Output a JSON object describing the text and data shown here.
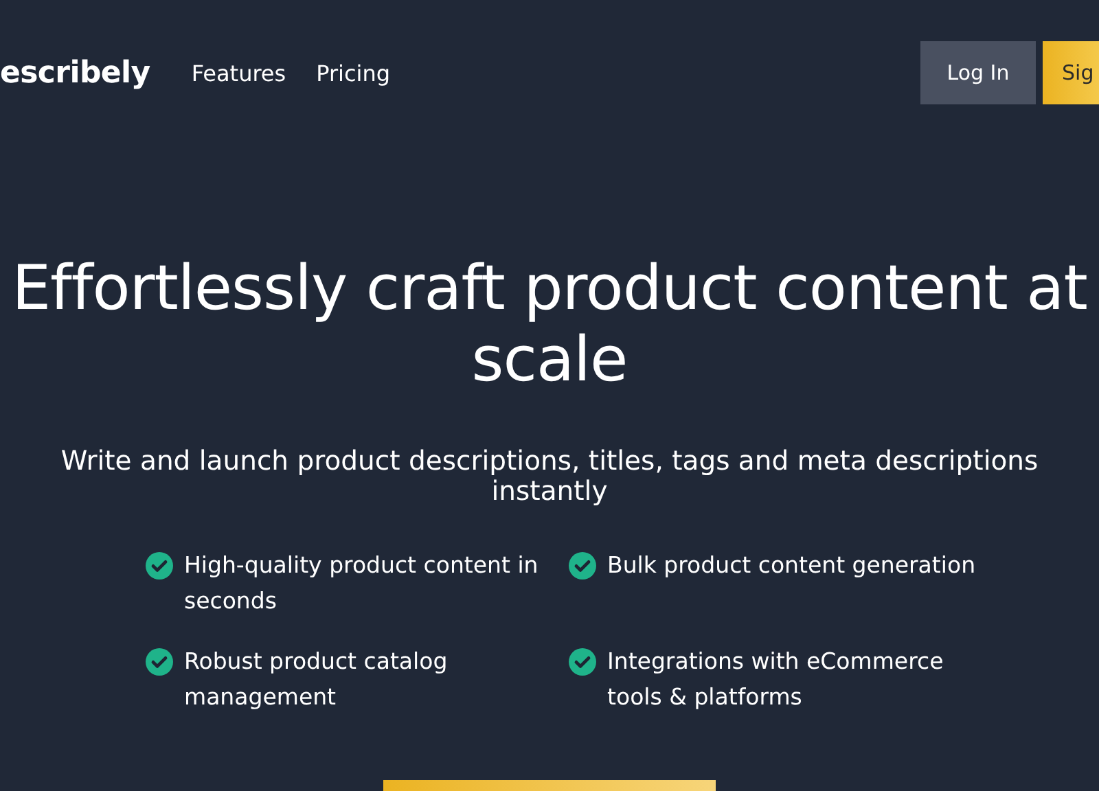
{
  "header": {
    "logo": "escribely",
    "nav": [
      {
        "label": "Features"
      },
      {
        "label": "Pricing"
      }
    ],
    "login": "Log In",
    "signup": "Sig"
  },
  "hero": {
    "title": "Effortlessly craft product content at scale",
    "subtitle": "Write and launch product descriptions, titles, tags and meta descriptions instantly",
    "features": [
      {
        "text": "High-quality product content in seconds"
      },
      {
        "text": "Bulk product content generation"
      },
      {
        "text": "Robust product catalog management"
      },
      {
        "text": "Integrations with eCommerce tools & platforms"
      }
    ]
  }
}
